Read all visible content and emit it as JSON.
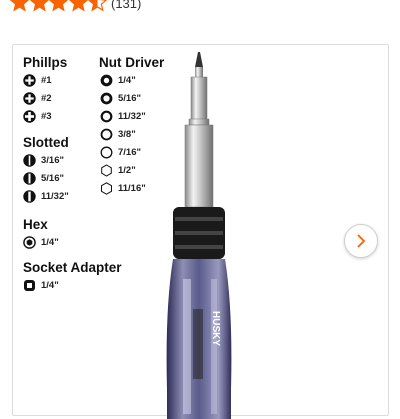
{
  "rating": {
    "stars": 4.5,
    "count_label": "(131)",
    "dropdown_icon": "chevron-down-icon",
    "star_color": "#f96302"
  },
  "legend": {
    "phillips": {
      "title": "Phillps",
      "items": [
        "#1",
        "#2",
        "#3"
      ]
    },
    "slotted": {
      "title": "Slotted",
      "items": [
        "3/16\"",
        "5/16\"",
        "11/32\""
      ]
    },
    "hex": {
      "title": "Hex",
      "items": [
        "1/4\""
      ]
    },
    "socket": {
      "title": "Socket Adapter",
      "items": [
        "1/4\""
      ]
    },
    "nut_driver": {
      "title": "Nut Driver",
      "items": [
        "1/4\"",
        "5/16\"",
        "11/32\"",
        "3/8\"",
        "7/16\"",
        "1/2\"",
        "11/16\""
      ]
    }
  },
  "product_image": {
    "brand_text": "HUSKY"
  },
  "gallery": {
    "next_icon": "chevron-right-icon",
    "accent": "#f96302"
  }
}
